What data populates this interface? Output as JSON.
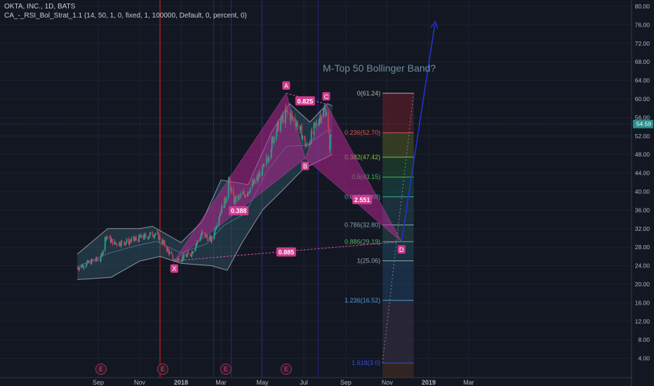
{
  "header": {
    "symbol_line": "OKTA, INC., 1D, BATS",
    "indicator_line": "CA_-_RSI_Bol_Strat_1.1 (14, 50, 1, 0, fixed, 1, 100000, Default, 0, percent, 0)"
  },
  "annotation_title": "M-Top 50 Bollinger Band?",
  "colors": {
    "background": "#131722",
    "pattern_fill": "#c0269a",
    "pattern_label": "#cf3b8e",
    "bollinger_fill": "#3d6b7a",
    "up_candle": "#2e9e8c",
    "down_candle": "#c2385a",
    "projection_arrow": "#2233cc",
    "red_vline": "#c21d1d",
    "blue_vline": "#2828a8",
    "price_tag": "#2a8e8b"
  },
  "chart_data": {
    "type": "candlestick",
    "x_axis_labels": [
      "Sep",
      "Nov",
      "2018",
      "Mar",
      "May",
      "Jul",
      "Sep",
      "Nov",
      "2019",
      "Mar"
    ],
    "y_axis_labels": [
      "80.00",
      "76.00",
      "72.00",
      "68.00",
      "64.00",
      "60.00",
      "56.00",
      "52.00",
      "48.00",
      "44.00",
      "40.00",
      "36.00",
      "32.00",
      "28.00",
      "24.00",
      "20.00",
      "16.00",
      "12.00",
      "8.00",
      "4.00"
    ],
    "ylim": [
      1.5,
      81.5
    ],
    "last_price": "54.59",
    "price_path": [
      [
        "2017-08-01",
        23.5
      ],
      [
        "2017-08-20",
        24.8
      ],
      [
        "2017-09-05",
        25.6
      ],
      [
        "2017-09-12",
        30.5
      ],
      [
        "2017-09-25",
        28.8
      ],
      [
        "2017-10-15",
        29.2
      ],
      [
        "2017-11-05",
        30.1
      ],
      [
        "2017-11-25",
        31.0
      ],
      [
        "2017-12-10",
        28.0
      ],
      [
        "2017-12-22",
        25.06
      ],
      [
        "2018-01-15",
        26.5
      ],
      [
        "2018-02-01",
        31.0
      ],
      [
        "2018-02-15",
        29.5
      ],
      [
        "2018-02-25",
        34.5
      ],
      [
        "2018-03-08",
        38.5
      ],
      [
        "2018-03-12",
        42.5
      ],
      [
        "2018-03-20",
        38.0
      ],
      [
        "2018-04-05",
        39.5
      ],
      [
        "2018-04-20",
        42.0
      ],
      [
        "2018-05-05",
        45.5
      ],
      [
        "2018-05-20",
        53.0
      ],
      [
        "2018-06-05",
        57.0
      ],
      [
        "2018-06-18",
        55.5
      ],
      [
        "2018-06-28",
        52.5
      ],
      [
        "2018-07-05",
        49.5
      ],
      [
        "2018-07-15",
        53.0
      ],
      [
        "2018-07-25",
        56.5
      ],
      [
        "2018-08-03",
        57.8
      ],
      [
        "2018-08-08",
        50.0
      ],
      [
        "2018-08-12",
        54.59
      ]
    ],
    "bollinger_upper": [
      [
        "2017-08-01",
        26.5
      ],
      [
        "2017-09-15",
        32.0
      ],
      [
        "2017-11-01",
        32.0
      ],
      [
        "2017-11-20",
        32.5
      ],
      [
        "2018-01-01",
        29.0
      ],
      [
        "2018-02-01",
        33.5
      ],
      [
        "2018-03-01",
        42.5
      ],
      [
        "2018-04-10",
        41.5
      ],
      [
        "2018-05-15",
        53.0
      ],
      [
        "2018-06-10",
        59.0
      ],
      [
        "2018-07-10",
        55.0
      ],
      [
        "2018-08-05",
        59.0
      ],
      [
        "2018-08-12",
        58.5
      ]
    ],
    "bollinger_lower": [
      [
        "2017-08-01",
        21.0
      ],
      [
        "2017-09-20",
        21.5
      ],
      [
        "2017-11-01",
        25.0
      ],
      [
        "2017-12-01",
        26.0
      ],
      [
        "2018-01-01",
        24.5
      ],
      [
        "2018-02-15",
        24.0
      ],
      [
        "2018-03-10",
        23.0
      ],
      [
        "2018-04-01",
        29.0
      ],
      [
        "2018-05-01",
        36.0
      ],
      [
        "2018-06-01",
        40.5
      ],
      [
        "2018-07-01",
        45.0
      ],
      [
        "2018-08-05",
        47.5
      ],
      [
        "2018-08-12",
        48.0
      ]
    ],
    "harmonic_pattern": {
      "points": [
        {
          "label": "X",
          "date": "2017-12-22",
          "price": 25.06
        },
        {
          "label": "A",
          "date": "2018-06-05",
          "price": 61.24
        },
        {
          "label": "B",
          "date": "2018-07-03",
          "price": 47.2
        },
        {
          "label": "C",
          "date": "2018-08-03",
          "price": 58.9
        },
        {
          "label": "D",
          "date": "2018-11-22",
          "price": 29.19
        }
      ],
      "ratios": [
        {
          "value": "0.825",
          "date": "2018-07-03",
          "price": 59.5
        },
        {
          "value": "0.388",
          "date": "2018-03-27",
          "price": 35.8
        },
        {
          "value": "2.551",
          "date": "2018-09-25",
          "price": 38.2
        },
        {
          "value": "0.885",
          "date": "2018-06-05",
          "price": 26.9
        }
      ]
    },
    "fibonacci": {
      "start_date": "2018-10-25",
      "end_date": "2018-12-10",
      "levels": [
        {
          "ratio": "0",
          "price": 61.24,
          "label": "0(61.24)",
          "color": "#b5b5b5",
          "fill": "#6a1f2b"
        },
        {
          "ratio": "0.236",
          "price": 52.7,
          "label": "0.236(52.70)",
          "color": "#e05252",
          "fill": "#4f5a24"
        },
        {
          "ratio": "0.382",
          "price": 47.42,
          "label": "0.382(47.42)",
          "color": "#8fbf40",
          "fill": "#1f5030"
        },
        {
          "ratio": "0.5",
          "price": 43.15,
          "label": "0.5(43.15)",
          "color": "#4fb35e",
          "fill": "#1a4f48"
        },
        {
          "ratio": "0.618",
          "price": 38.88,
          "label": "0.618(38.88)",
          "color": "#3aaea2",
          "fill": "#254652"
        },
        {
          "ratio": "0.786",
          "price": 32.8,
          "label": "0.786(32.80)",
          "color": "#7da4b2",
          "fill": "#2a4a4c"
        },
        {
          "ratio": "0.886",
          "price": 29.19,
          "label": "0.886(29.19)",
          "color": "#5ab56c",
          "fill": "#1c4a5c"
        },
        {
          "ratio": "1",
          "price": 25.06,
          "label": "1(25.06)",
          "color": "#9aa2ad",
          "fill": "#1f3f63"
        },
        {
          "ratio": "1.236",
          "price": 16.52,
          "label": "1.236(16.52)",
          "color": "#4d9ad9",
          "fill": "#3a3147"
        },
        {
          "ratio": "1.618",
          "price": 3.0,
          "label": "1.618(3.0)",
          "color": "#3a4ed8",
          "fill": "#4a2f22"
        }
      ]
    },
    "projection_target": {
      "date": "2019-01-10",
      "price": 76.0
    },
    "earnings_markers": [
      {
        "label": "E",
        "date": "2017-09-05"
      },
      {
        "label": "E",
        "date": "2017-12-05"
      },
      {
        "label": "E",
        "date": "2018-03-08"
      },
      {
        "label": "E",
        "date": "2018-06-05"
      }
    ],
    "vertical_lines": [
      {
        "date": "2017-12-01",
        "kind": "red"
      },
      {
        "date": "2018-02-18",
        "kind": "blue"
      },
      {
        "date": "2018-03-16",
        "kind": "blue"
      },
      {
        "date": "2018-04-30",
        "kind": "blue"
      },
      {
        "date": "2018-07-22",
        "kind": "blue"
      }
    ]
  }
}
